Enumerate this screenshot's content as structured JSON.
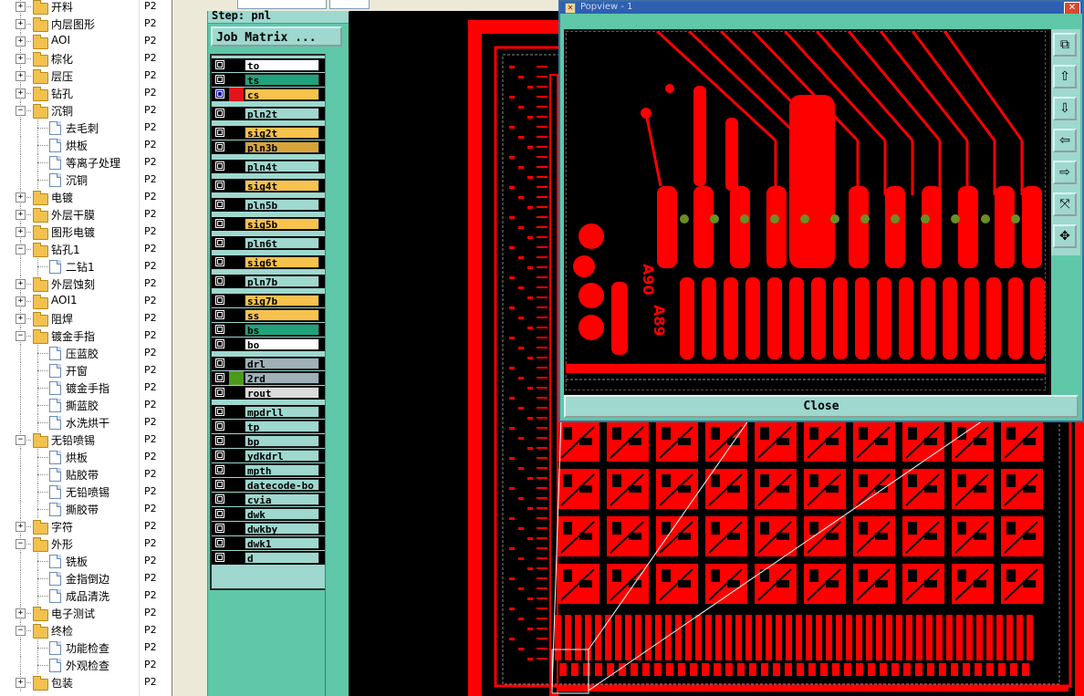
{
  "tree": {
    "items": [
      {
        "label": "开料",
        "code": "P2",
        "level": 0,
        "type": "folder"
      },
      {
        "label": "内层图形",
        "code": "P2",
        "level": 0,
        "type": "folder"
      },
      {
        "label": "AOI",
        "code": "P2",
        "level": 0,
        "type": "folder"
      },
      {
        "label": "棕化",
        "code": "P2",
        "level": 0,
        "type": "folder"
      },
      {
        "label": "层压",
        "code": "P2",
        "level": 0,
        "type": "folder"
      },
      {
        "label": "钻孔",
        "code": "P2",
        "level": 0,
        "type": "folder"
      },
      {
        "label": "沉铜",
        "code": "P2",
        "level": 0,
        "type": "folder",
        "expanded": true
      },
      {
        "label": "去毛刺",
        "code": "P2",
        "level": 1,
        "type": "doc"
      },
      {
        "label": "烘板",
        "code": "P2",
        "level": 1,
        "type": "doc"
      },
      {
        "label": "等离子处理",
        "code": "P2",
        "level": 1,
        "type": "doc"
      },
      {
        "label": "沉铜",
        "code": "P2",
        "level": 1,
        "type": "doc"
      },
      {
        "label": "电镀",
        "code": "P2",
        "level": 0,
        "type": "folder"
      },
      {
        "label": "外层干膜",
        "code": "P2",
        "level": 0,
        "type": "folder"
      },
      {
        "label": "图形电镀",
        "code": "P2",
        "level": 0,
        "type": "folder"
      },
      {
        "label": "钻孔1",
        "code": "P2",
        "level": 0,
        "type": "folder",
        "expanded": true
      },
      {
        "label": "二钻1",
        "code": "P2",
        "level": 1,
        "type": "doc"
      },
      {
        "label": "外层蚀刻",
        "code": "P2",
        "level": 0,
        "type": "folder"
      },
      {
        "label": "AOI1",
        "code": "P2",
        "level": 0,
        "type": "folder"
      },
      {
        "label": "阻焊",
        "code": "P2",
        "level": 0,
        "type": "folder"
      },
      {
        "label": "镀金手指",
        "code": "P2",
        "level": 0,
        "type": "folder",
        "expanded": true
      },
      {
        "label": "压蓝胶",
        "code": "P2",
        "level": 1,
        "type": "doc"
      },
      {
        "label": "开窗",
        "code": "P2",
        "level": 1,
        "type": "doc"
      },
      {
        "label": "镀金手指",
        "code": "P2",
        "level": 1,
        "type": "doc"
      },
      {
        "label": "撕蓝胶",
        "code": "P2",
        "level": 1,
        "type": "doc"
      },
      {
        "label": "水洗烘干",
        "code": "P2",
        "level": 1,
        "type": "doc"
      },
      {
        "label": "无铅喷锡",
        "code": "P2",
        "level": 0,
        "type": "folder",
        "expanded": true
      },
      {
        "label": "烘板",
        "code": "P2",
        "level": 1,
        "type": "doc"
      },
      {
        "label": "贴胶带",
        "code": "P2",
        "level": 1,
        "type": "doc"
      },
      {
        "label": "无铅喷锡",
        "code": "P2",
        "level": 1,
        "type": "doc"
      },
      {
        "label": "撕胶带",
        "code": "P2",
        "level": 1,
        "type": "doc"
      },
      {
        "label": "字符",
        "code": "P2",
        "level": 0,
        "type": "folder"
      },
      {
        "label": "外形",
        "code": "P2",
        "level": 0,
        "type": "folder",
        "expanded": true
      },
      {
        "label": "铣板",
        "code": "P2",
        "level": 1,
        "type": "doc"
      },
      {
        "label": "金指倒边",
        "code": "P2",
        "level": 1,
        "type": "doc"
      },
      {
        "label": "成品清洗",
        "code": "P2",
        "level": 1,
        "type": "doc"
      },
      {
        "label": "电子测试",
        "code": "P2",
        "level": 0,
        "type": "folder"
      },
      {
        "label": "终检",
        "code": "P2",
        "level": 0,
        "type": "folder",
        "expanded": true
      },
      {
        "label": "功能检查",
        "code": "P2",
        "level": 1,
        "type": "doc"
      },
      {
        "label": "外观检查",
        "code": "P2",
        "level": 1,
        "type": "doc"
      },
      {
        "label": "包装",
        "code": "P2",
        "level": 0,
        "type": "folder"
      }
    ]
  },
  "panel": {
    "step_label": "Step: pnl",
    "job_matrix_button": "Job Matrix ...",
    "layer_groups": [
      [
        {
          "name": "to",
          "bg": "#ffffff",
          "swatch": "#000000"
        },
        {
          "name": "ts",
          "bg": "#1fa37c",
          "swatch": "#000000"
        },
        {
          "name": "cs",
          "bg": "#f7c24d",
          "swatch": "#e3141b",
          "selected": true
        }
      ],
      [
        {
          "name": "pln2t",
          "bg": "#9ed8cf",
          "swatch": "#000000"
        }
      ],
      [
        {
          "name": "sig2t",
          "bg": "#f7c24d",
          "swatch": "#000000"
        },
        {
          "name": "pln3b",
          "bg": "#d8a43a",
          "swatch": "#000000"
        }
      ],
      [
        {
          "name": "pln4t",
          "bg": "#9ed8cf",
          "swatch": "#000000"
        }
      ],
      [
        {
          "name": "sig4t",
          "bg": "#f7c24d",
          "swatch": "#000000"
        }
      ],
      [
        {
          "name": "pln5b",
          "bg": "#9ed8cf",
          "swatch": "#000000"
        }
      ],
      [
        {
          "name": "sig5b",
          "bg": "#f7c24d",
          "swatch": "#000000"
        }
      ],
      [
        {
          "name": "pln6t",
          "bg": "#9ed8cf",
          "swatch": "#000000"
        }
      ],
      [
        {
          "name": "sig6t",
          "bg": "#f7c24d",
          "swatch": "#000000"
        }
      ],
      [
        {
          "name": "pln7b",
          "bg": "#9ed8cf",
          "swatch": "#000000"
        }
      ],
      [
        {
          "name": "sig7b",
          "bg": "#f7c24d",
          "swatch": "#000000"
        },
        {
          "name": "ss",
          "bg": "#f7c24d",
          "swatch": "#000000"
        },
        {
          "name": "bs",
          "bg": "#1fa37c",
          "swatch": "#000000"
        },
        {
          "name": "bo",
          "bg": "#ffffff",
          "swatch": "#000000"
        }
      ],
      [
        {
          "name": "drl",
          "bg": "#9fb0b8",
          "swatch": "#000000"
        },
        {
          "name": "2rd",
          "bg": "#9fb0b8",
          "swatch": "#4b9a1e"
        },
        {
          "name": "rout",
          "bg": "#dcdcdc",
          "swatch": "#000000"
        }
      ],
      [
        {
          "name": "mpdrll",
          "bg": "#9ed8cf",
          "swatch": "#000000"
        },
        {
          "name": "tp",
          "bg": "#9ed8cf",
          "swatch": "#000000"
        },
        {
          "name": "bp",
          "bg": "#9ed8cf",
          "swatch": "#000000"
        },
        {
          "name": "ydkdrl",
          "bg": "#9ed8cf",
          "swatch": "#000000"
        },
        {
          "name": "mpth",
          "bg": "#9ed8cf",
          "swatch": "#000000"
        },
        {
          "name": "datecode-bo",
          "bg": "#9ed8cf",
          "swatch": "#000000"
        },
        {
          "name": "cvia",
          "bg": "#9ed8cf",
          "swatch": "#000000"
        },
        {
          "name": "dwk",
          "bg": "#9ed8cf",
          "swatch": "#000000"
        },
        {
          "name": "dwkby",
          "bg": "#9ed8cf",
          "swatch": "#000000"
        },
        {
          "name": "dwk1",
          "bg": "#9ed8cf",
          "swatch": "#000000"
        },
        {
          "name": "d",
          "bg": "#9ed8cf",
          "swatch": "#000000"
        }
      ]
    ]
  },
  "popview": {
    "title": "Popview - 1",
    "close_button": "Close",
    "pad_labels": [
      "A90",
      "A89"
    ],
    "tools": [
      "zoom-window-icon",
      "pan-up-icon",
      "pan-down-icon",
      "pan-left-icon",
      "pan-right-icon",
      "zoom-fit-icon",
      "zoom-home-icon"
    ]
  },
  "colors": {
    "copper": "#ff0000",
    "panel_bg": "#5ec8a8",
    "button_bg": "#9ed8cf",
    "via_green": "#6b8e23"
  }
}
